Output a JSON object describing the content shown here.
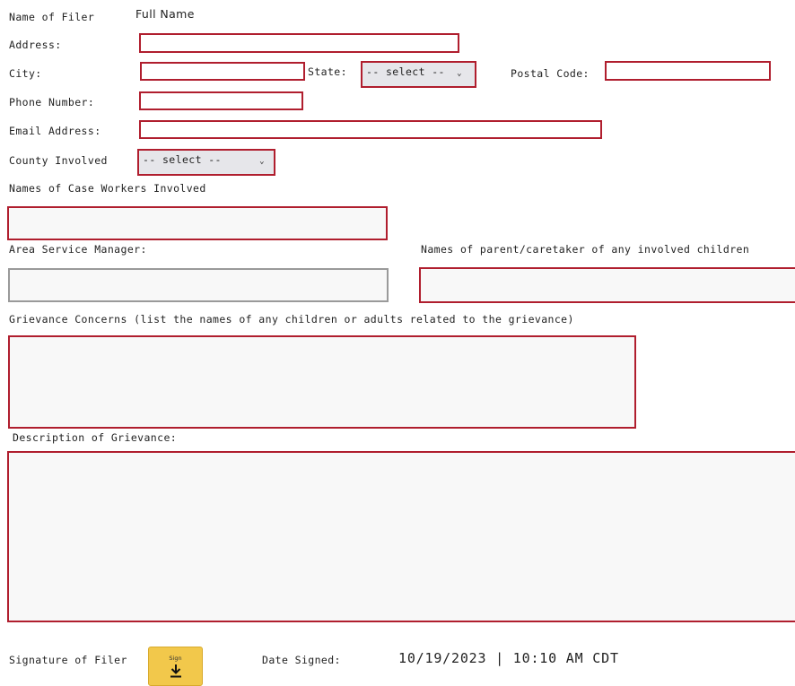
{
  "labels": {
    "name_of_filer": "Name of Filer",
    "full_name": "Full Name",
    "address": "Address:",
    "city": "City:",
    "state": "State:",
    "postal_code": "Postal Code:",
    "phone": "Phone Number:",
    "email": "Email Address:",
    "county": "County Involved",
    "case_workers": "Names of  Case Workers Involved",
    "area_service_manager": "Area Service Manager:",
    "parents": "Names of parent/caretaker of any involved children",
    "grievance_concerns": "Grievance Concerns (list the names of any children or adults related to the grievance)",
    "description": "Description of Grievance:",
    "signature": "Signature of Filer",
    "date_signed": "Date Signed:"
  },
  "state_select": {
    "value": "-- select --"
  },
  "county_select": {
    "value": "-- select --"
  },
  "sign_button": {
    "label": "Sign"
  },
  "date_signed_value": "10/19/2023 | 10:10 AM CDT",
  "icons": {
    "select_chevron": "chevron-down-icon",
    "sign": "download-arrow-icon"
  },
  "colors": {
    "required_border": "#b01e2e",
    "optional_border": "#9a9a9a",
    "sign_button": "#f2c84b"
  }
}
